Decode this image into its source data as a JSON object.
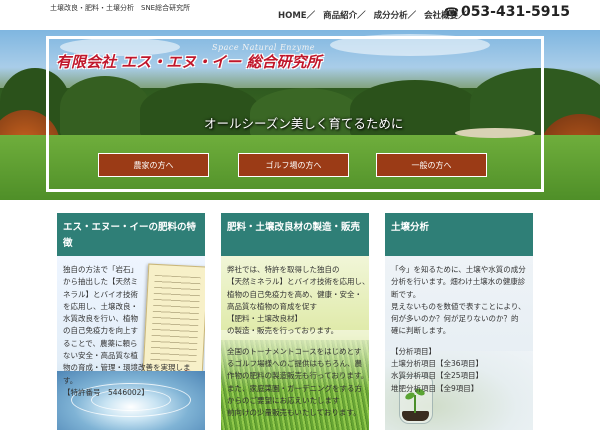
{
  "header": {
    "tagline": "土壌改良・肥料・土壌分析　SNE総合研究所",
    "nav": [
      "HOME／",
      "商品紹介／",
      "成分分析／",
      "会社概要／"
    ],
    "phone": "053-431-5915",
    "phone_icon": "telephone-icon"
  },
  "hero": {
    "company_sub": "Space Natural Enzyme",
    "company_name": "有限会社 エス・エヌ・イー 総合研究所",
    "catch": "オールシーズン美しく育てるために",
    "buttons": [
      "農家の方へ",
      "ゴルフ場の方へ",
      "一般の方へ"
    ]
  },
  "cards": [
    {
      "title_lines": [
        "エス・エヌー・イーの肥料の特",
        "徴"
      ],
      "text_lines": [
        "独自の方法で「岩石」",
        "から抽出した【天然ミ",
        "ネラル】とバイオ技術",
        "を応用し、土壌改良・",
        "水質改良を行い、植物",
        "の自己免疫力を向上す",
        "ることで、農薬に頼ら",
        "ない安全・高品質な植",
        "物の育成・管理・環境改善を実現しま",
        "す。",
        "【特許番号　5446002】"
      ]
    },
    {
      "title_lines": [
        "肥料・土壌改良材の製造・販売"
      ],
      "text_lines": [
        "弊社では、特許を取得した独自の",
        "【天然ミネラル】とバイオ技術を応用し、",
        "植物の自己免疫力を高め、健康・安全・",
        "高品質な植物の育成を促す",
        "【肥料・土壌改良材】",
        "の製造・販売を行っております。",
        "",
        "全国のトーナメントコースをはじめとす",
        "るゴルフ場様へのご提供はもちろん、農",
        "作物の肥料の製造販売も行っております。",
        "また、家庭菜園・ガーデニングをする方",
        "からのご要望にお応えいたします",
        "前向けの少量販売もいたしております。"
      ]
    },
    {
      "title_lines": [
        "土壌分析"
      ],
      "text_lines": [
        "「今」を知るために、土壌や水質の成分",
        "分析を行います。畑わけ土壌水の健康診",
        "断です。",
        "見えないものを数値で表すことにより、",
        "何が多いのか？何が足りないのか？的",
        "確に判断します。",
        "",
        "【分析項目】",
        "土壌分析項目【全36項目】",
        "水質分析項目【全25項目】",
        "堆肥分析項目【全9項目】"
      ]
    }
  ]
}
